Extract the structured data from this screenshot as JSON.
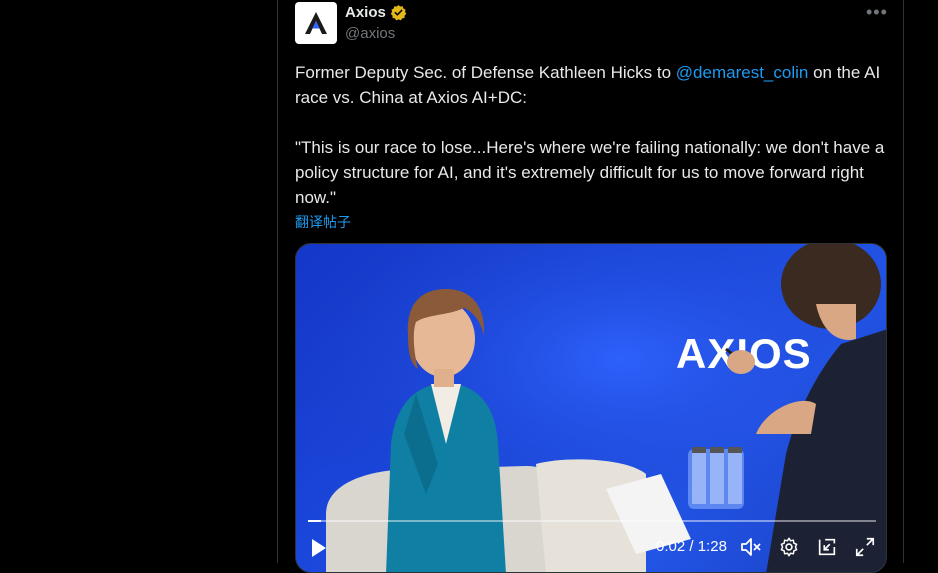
{
  "tweet": {
    "author_name": "Axios",
    "author_handle": "@axios",
    "verified": true,
    "line1_pre": "Former Deputy Sec. of Defense Kathleen Hicks to ",
    "mention": "@demarest_colin",
    "line1_post": " on the AI race vs. China at Axios AI+DC:",
    "quote": "\"This is our race to lose...Here's where we're failing nationally: we don't have a policy structure for AI, and it's extremely difficult for us to move forward right now.\"",
    "translate_label": "翻译帖子"
  },
  "video": {
    "stage_logo": "AXIOS",
    "current_time": "0:02",
    "separator": " / ",
    "duration": "1:28",
    "progress": 0.023
  },
  "icons": {
    "more": "more-icon",
    "verified": "verified-badge-icon",
    "play": "play-icon",
    "mute": "volume-muted-icon",
    "settings": "gear-icon",
    "pip": "picture-in-picture-icon",
    "fullscreen": "fullscreen-icon"
  },
  "colors": {
    "background": "#000000",
    "text": "#e7e9ea",
    "secondary": "#71767b",
    "link": "#1d9bf0",
    "verified": "#e2b719",
    "video_blue": "#1d4be0"
  }
}
